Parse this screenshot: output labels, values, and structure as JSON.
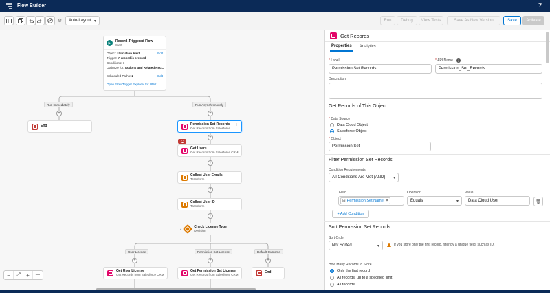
{
  "app": {
    "title": "Flow Builder",
    "help": "?"
  },
  "toolbar": {
    "layout_select": "Auto-Layout",
    "run": "Run",
    "debug": "Debug",
    "view_tests": "View Tests",
    "save_as_new_version": "Save As New Version",
    "save": "Save",
    "activate": "Activate"
  },
  "canvas": {
    "start": {
      "title": "Record-Triggered Flow",
      "subtitle": "Start",
      "object_label": "Object:",
      "object_value": "Utilization Alert",
      "trigger_label": "Trigger:",
      "trigger_value": "A record is created",
      "conditions": "Conditions: 1",
      "optimize_label": "Optimize for:",
      "optimize_value": "Actions and Related Rec...",
      "scheduled_paths_label": "Scheduled Paths:",
      "scheduled_paths_value": "2",
      "edit": "Edit",
      "explorer_link": "Open Flow Trigger Explorer for Utiliz..."
    },
    "paths": {
      "immediately": "Run Immediately",
      "async": "Run Asynchronously"
    },
    "end_label": "End",
    "nodes": {
      "perm_set_records": {
        "title": "Permission Set Records",
        "subtitle": "Get Records from Salesforce ..."
      },
      "get_users": {
        "title": "Get Users",
        "subtitle": "Get Records from Salesforce CRM"
      },
      "collect_emails": {
        "title": "Collect User Emails",
        "subtitle": "Transform"
      },
      "collect_id": {
        "title": "Collect User ID",
        "subtitle": "Transform"
      },
      "license_type": {
        "title": "Check License Type",
        "subtitle": "Decision"
      },
      "get_user_license": {
        "title": "Get User License",
        "subtitle": "Get Records from Salesforce CRM"
      },
      "get_perm_set_license": {
        "title": "Get Permission Set License",
        "subtitle": "Get Records from Salesforce CRM"
      }
    },
    "outcomes": {
      "user_license": "User License",
      "perm_set_license": "Permission Set License",
      "default": "Default Outcome"
    }
  },
  "panel": {
    "title": "Get Records",
    "tabs": [
      "Properties",
      "Analytics"
    ],
    "label_label": "Label",
    "label_value": "Permission Set Records",
    "api_name_label": "API Name",
    "api_name_value": "Permission_Set_Records",
    "description_label": "Description",
    "section_get_records": "Get Records of This Object",
    "data_source_label": "Data Source",
    "data_source_options": [
      "Data Cloud Object",
      "Salesforce Object"
    ],
    "object_label": "Object",
    "object_value": "Permission Set",
    "section_filter": "Filter Permission Set Records",
    "condition_req_label": "Condition Requirements",
    "condition_req_value": "All Conditions Are Met (AND)",
    "field_label": "Field",
    "field_value": "Permission Set Name",
    "operator_label": "Operator",
    "operator_value": "Equals",
    "value_label": "Value",
    "value_value": "Data Cloud User",
    "add_condition": "+ Add Condition",
    "section_sort": "Sort Permission Set Records",
    "sort_order_label": "Sort Order",
    "sort_order_value": "Not Sorted",
    "sort_warning": "If you store only the first record, filter by a unique field, such as ID.",
    "how_many_label": "How Many Records to Store",
    "how_many_options": [
      "Only the first record",
      "All records, up to a specified limit",
      "All records"
    ]
  },
  "colors": {
    "brand_navy": "#0b2a57",
    "accent_blue": "#0176d3",
    "get_records_pink": "#e3066a",
    "end_red": "#c23934",
    "transform_orange": "#dd7a01",
    "start_teal": "#0b827c"
  },
  "icons": [
    "flow-builder-logo",
    "play-icon",
    "undo-icon",
    "redo-icon",
    "info-icon",
    "warning-icon",
    "trash-icon",
    "zoom-in-icon",
    "zoom-out-icon",
    "fit-icon"
  ]
}
